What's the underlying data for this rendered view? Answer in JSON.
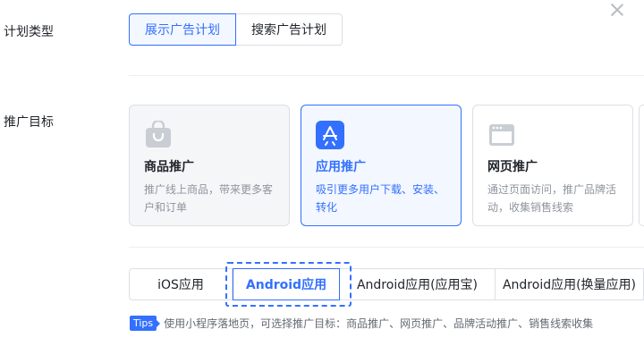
{
  "plan_type": {
    "label": "计划类型",
    "options": [
      "展示广告计划",
      "搜索广告计划"
    ],
    "selected": "展示广告计划"
  },
  "goal": {
    "label": "推广目标",
    "cards": [
      {
        "icon": "shopping-bag-icon",
        "title": "商品推广",
        "desc": "推广线上商品，带来更多客户和订单"
      },
      {
        "icon": "app-store-icon",
        "title": "应用推广",
        "desc": "吸引更多用户下载、安装、转化"
      },
      {
        "icon": "browser-window-icon",
        "title": "网页推广",
        "desc": "通过页面访问，推广品牌活动，收集销售线索"
      }
    ],
    "selected": "应用推广"
  },
  "app_tabs": {
    "items": [
      "iOS应用",
      "Android应用",
      "Android应用(应用宝)",
      "Android应用(换量应用)"
    ],
    "selected": "Android应用"
  },
  "tips": {
    "badge": "Tips",
    "text": "使用小程序落地页，可选择推广目标：商品推广、网页推广、品牌活动推广、销售线索收集"
  },
  "colors": {
    "accent": "#3370ff",
    "border": "#dcdfe5",
    "text": "#1f2329",
    "muted": "#8f959e"
  }
}
